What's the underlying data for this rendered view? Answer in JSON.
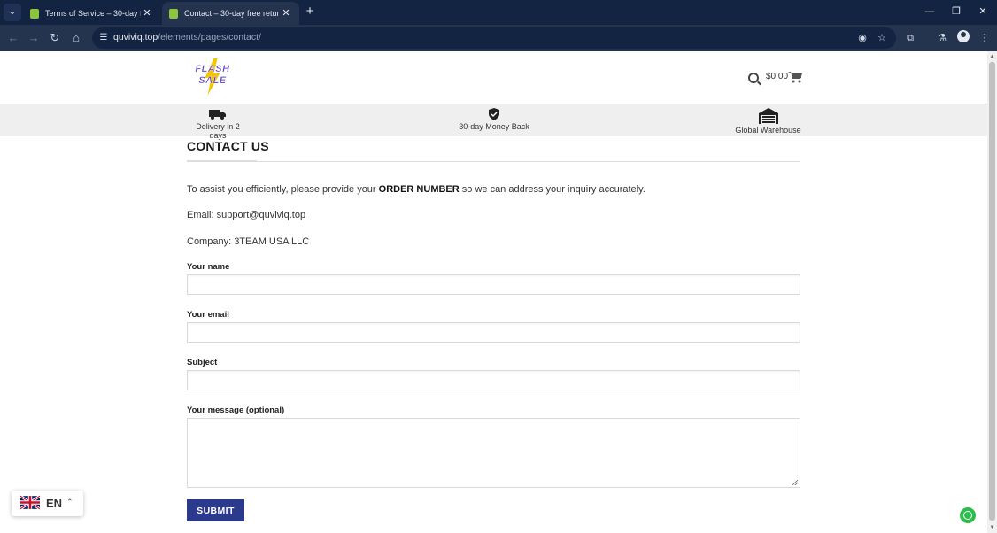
{
  "browser": {
    "tabs": [
      {
        "title": "Terms of Service – 30-day free r",
        "active": false
      },
      {
        "title": "Contact – 30-day free return &",
        "active": true
      }
    ],
    "url_host": "quviviq.top",
    "url_path": "/elements/pages/contact/"
  },
  "header": {
    "logo_line1": "FLASH",
    "logo_line2": "SALE",
    "cart_total": "$0.00"
  },
  "features": [
    {
      "icon": "truck-icon",
      "label": "Delivery in 2 days"
    },
    {
      "icon": "shield-check-icon",
      "label": "30-day Money Back"
    },
    {
      "icon": "warehouse-icon",
      "label": "Global Warehouse"
    }
  ],
  "page": {
    "title": "CONTACT US",
    "intro_before": "To assist you efficiently, please provide your ",
    "intro_bold": "ORDER NUMBER",
    "intro_after": " so we can address your inquiry accurately.",
    "email": "Email: support@quviviq.top",
    "company": "Company: 3TEAM USA LLC"
  },
  "form": {
    "name_label": "Your name",
    "email_label": "Your email",
    "subject_label": "Subject",
    "message_label": "Your message (optional)",
    "name_value": "",
    "email_value": "",
    "subject_value": "",
    "message_value": "",
    "submit_label": "SUBMIT"
  },
  "language": {
    "code": "EN"
  },
  "colors": {
    "accent": "#2b3a8c",
    "browser_frame": "#132342",
    "feature_bar": "#efefef"
  }
}
